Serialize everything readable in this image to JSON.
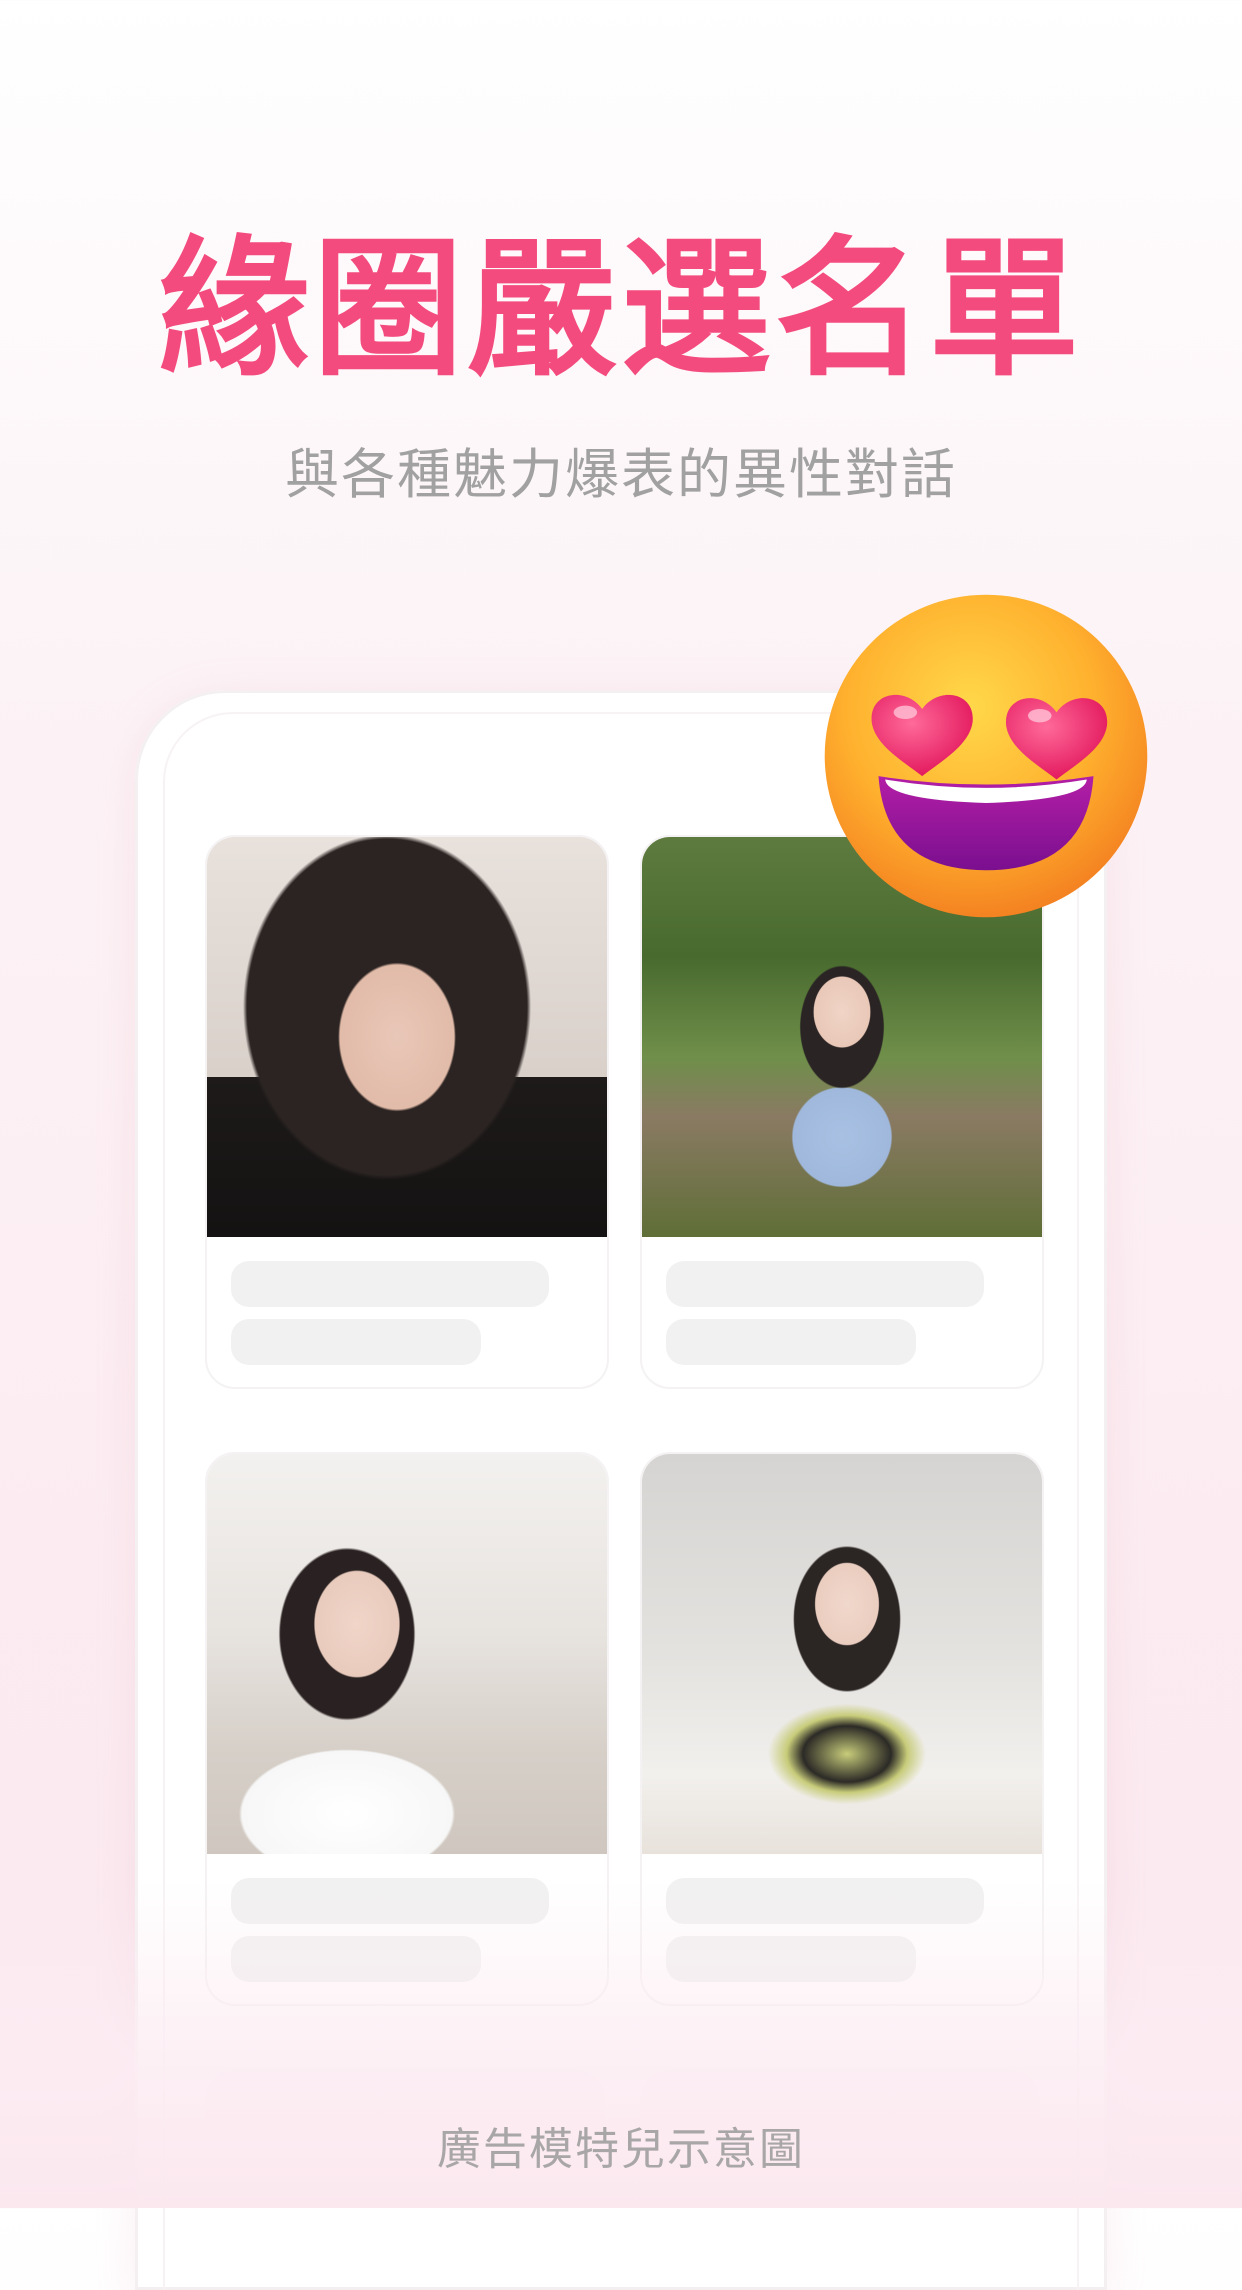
{
  "headline": "緣圈嚴選名單",
  "subtitle": "與各種魅力爆表的異性對話",
  "emoji": "heart-eyes-emoji",
  "cards": [
    {
      "photo": "profile-photo-woman-selfie-black-cardigan"
    },
    {
      "photo": "profile-photo-woman-garden-blue-dress"
    },
    {
      "photo": "profile-photo-woman-mirror-selfie-white-top"
    },
    {
      "photo": "profile-photo-woman-striped-sweater-cafe"
    }
  ],
  "caption": "廣告模特兒示意圖",
  "colors": {
    "headline": "#f44b7e",
    "subtitle": "#a1a1a1",
    "placeholder": "#f1f1f1",
    "background_bottom": "#fbe7ee"
  }
}
